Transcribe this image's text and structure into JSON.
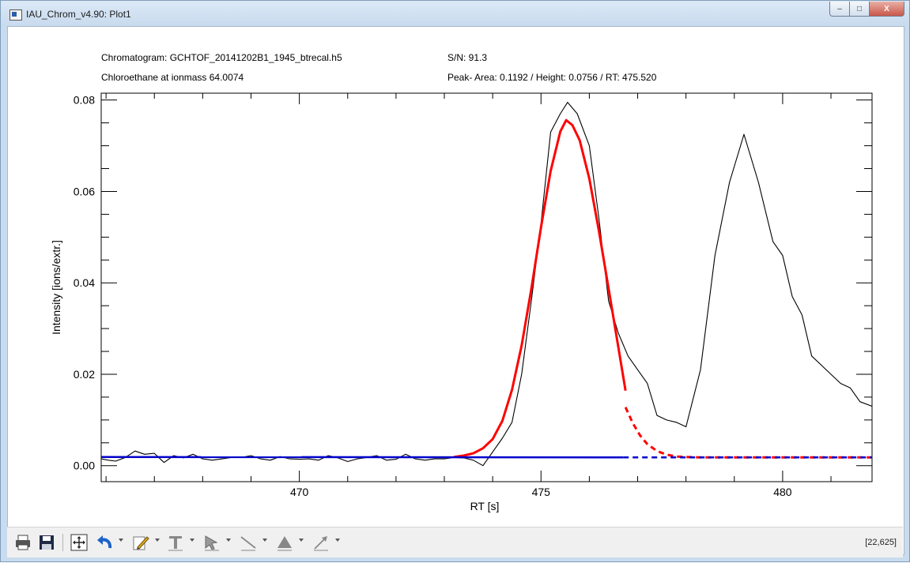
{
  "window": {
    "title": "IAU_Chrom_v4.90: Plot1",
    "controls": {
      "minimize": "–",
      "maximize": "□",
      "close": "X"
    }
  },
  "header": {
    "chromatogram": "Chromatogram: GCHTOF_20141202B1_1945_btrecal.h5",
    "compound": "Chloroethane at ionmass 64.0074",
    "sn": "S/N: 91.3",
    "peak": "Peak- Area: 0.1192 / Height: 0.0756 / RT: 475.520"
  },
  "colors": {
    "raw": "#000000",
    "fit": "#ff0000",
    "baseline": "#0000cc"
  },
  "toolbar": {
    "items": [
      "print-icon",
      "save-icon",
      "fit-view-icon",
      "undo-icon",
      "pencil-icon",
      "text-icon",
      "select-icon",
      "line-icon",
      "shape-icon",
      "arrow-icon"
    ],
    "coords": "[22,625]"
  },
  "chart_data": {
    "type": "line",
    "xlabel": "RT [s]",
    "ylabel": "Intensity [ions/extr.]",
    "xlim": [
      465.9,
      481.85
    ],
    "ylim": [
      -0.0035,
      0.0815
    ],
    "xticks": [
      470,
      475,
      480
    ],
    "xtick_labels": [
      "470",
      "475",
      "480"
    ],
    "yticks": [
      0.0,
      0.02,
      0.04,
      0.06,
      0.08
    ],
    "ytick_labels": [
      "0.00",
      "0.02",
      "0.04",
      "0.06",
      "0.08"
    ],
    "grid": false,
    "series": [
      {
        "style": "solid",
        "color": "#000000",
        "x": [
          465.9,
          466.05,
          466.2,
          466.4,
          466.6,
          466.8,
          467.0,
          467.2,
          467.4,
          467.6,
          467.8,
          468.0,
          468.2,
          468.4,
          468.6,
          468.8,
          469.0,
          469.2,
          469.4,
          469.6,
          469.8,
          470.0,
          470.2,
          470.4,
          470.6,
          470.8,
          471.0,
          471.2,
          471.4,
          471.6,
          471.8,
          472.0,
          472.2,
          472.4,
          472.6,
          472.8,
          473.0,
          473.2,
          473.4,
          473.6,
          473.8,
          474.0,
          474.2,
          474.4,
          474.6,
          474.8,
          475.0,
          475.2,
          475.4,
          475.55,
          475.75,
          476.0,
          476.2,
          476.4,
          476.6,
          476.8,
          477.0,
          477.2,
          477.4,
          477.6,
          477.8,
          478.0,
          478.3,
          478.6,
          478.9,
          479.2,
          479.5,
          479.8,
          480.0,
          480.2,
          480.4,
          480.6,
          480.8,
          481.0,
          481.2,
          481.4,
          481.6,
          481.85
        ],
        "y": [
          0.0015,
          0.0012,
          0.001,
          0.0018,
          0.0032,
          0.0025,
          0.0027,
          0.0007,
          0.0022,
          0.0017,
          0.0025,
          0.0015,
          0.0012,
          0.0015,
          0.0018,
          0.0018,
          0.0022,
          0.0015,
          0.0012,
          0.002,
          0.0015,
          0.0014,
          0.0015,
          0.0012,
          0.0022,
          0.0017,
          0.0009,
          0.0015,
          0.0018,
          0.0022,
          0.0012,
          0.0014,
          0.0025,
          0.0015,
          0.0012,
          0.0015,
          0.0015,
          0.0018,
          0.0017,
          0.0012,
          0.0,
          0.003,
          0.006,
          0.0095,
          0.02,
          0.036,
          0.053,
          0.073,
          0.077,
          0.0795,
          0.077,
          0.07,
          0.054,
          0.036,
          0.029,
          0.024,
          0.021,
          0.018,
          0.011,
          0.01,
          0.0095,
          0.0085,
          0.021,
          0.046,
          0.062,
          0.0725,
          0.062,
          0.049,
          0.046,
          0.037,
          0.033,
          0.024,
          0.022,
          0.02,
          0.018,
          0.017,
          0.014,
          0.013
        ]
      },
      {
        "style": "solid",
        "color": "#ff0000",
        "x": [
          473.2,
          473.4,
          473.6,
          473.8,
          474.0,
          474.2,
          474.4,
          474.6,
          474.8,
          475.0,
          475.2,
          475.4,
          475.52,
          475.65,
          475.8,
          476.0,
          476.2,
          476.4,
          476.6,
          476.75
        ],
        "y": [
          0.0019,
          0.0022,
          0.0027,
          0.0038,
          0.0058,
          0.0098,
          0.0166,
          0.0263,
          0.0386,
          0.0522,
          0.0645,
          0.0731,
          0.0756,
          0.0745,
          0.0712,
          0.0628,
          0.0513,
          0.0387,
          0.0259,
          0.0164
        ]
      },
      {
        "style": "dashed",
        "color": "#ff0000",
        "x": [
          476.75,
          476.9,
          477.05,
          477.2,
          477.4,
          477.6,
          477.8,
          478.0,
          478.3,
          478.6,
          479.0,
          479.5,
          480.0,
          480.5,
          481.0,
          481.5,
          481.85
        ],
        "y": [
          0.0128,
          0.0093,
          0.0066,
          0.0047,
          0.0032,
          0.0024,
          0.002,
          0.0019,
          0.0018,
          0.0018,
          0.0018,
          0.0018,
          0.0018,
          0.0018,
          0.0018,
          0.0018,
          0.0018
        ]
      },
      {
        "style": "solid",
        "color": "#0000cc",
        "x": [
          465.9,
          476.7
        ],
        "y": [
          0.0019,
          0.0018
        ]
      },
      {
        "style": "dashed",
        "color": "#0000cc",
        "x": [
          476.7,
          481.85
        ],
        "y": [
          0.0018,
          0.0018
        ]
      }
    ]
  }
}
